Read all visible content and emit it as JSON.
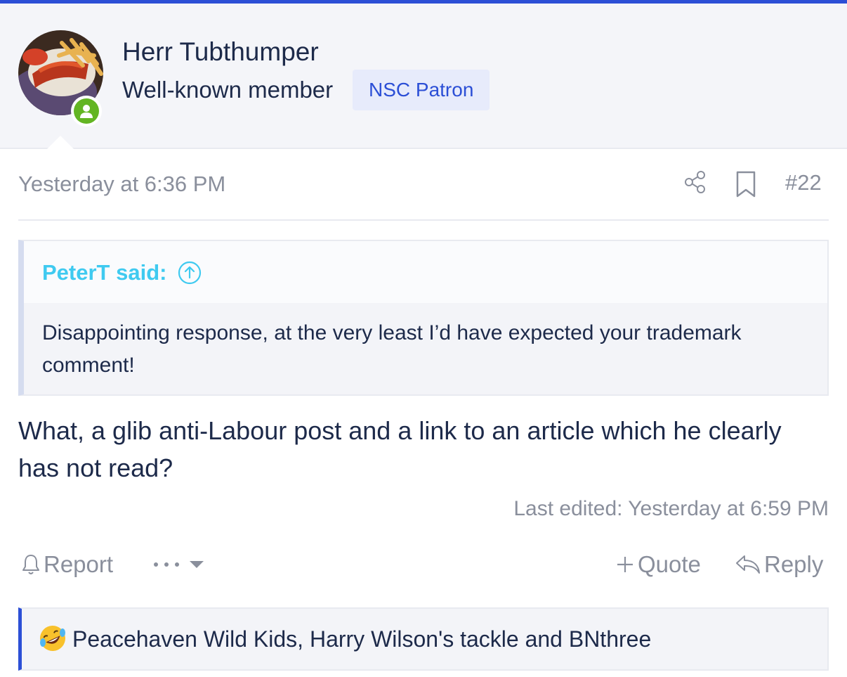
{
  "user": {
    "name": "Herr Tubthumper",
    "title": "Well-known member",
    "banner": "NSC Patron"
  },
  "post": {
    "date": "Yesterday at 6:36 PM",
    "number": "#22",
    "quote": {
      "author": "PeterT said:",
      "text": "Disappointing response, at the very least I’d have expected your trademark comment!"
    },
    "message": "What, a glib anti-Labour post and a link to an article which he clearly has not read?",
    "last_edited": "Last edited: Yesterday at 6:59 PM"
  },
  "actions": {
    "report": "Report",
    "quote": "Quote",
    "reply": "Reply"
  },
  "reactions": {
    "text": "Peacehaven Wild Kids, Harry Wilson's tackle and BNthree"
  },
  "colors": {
    "accent": "#2c4fd6",
    "quote_author": "#3fcaf0",
    "online": "#63b523",
    "muted": "#8a8f9c"
  }
}
